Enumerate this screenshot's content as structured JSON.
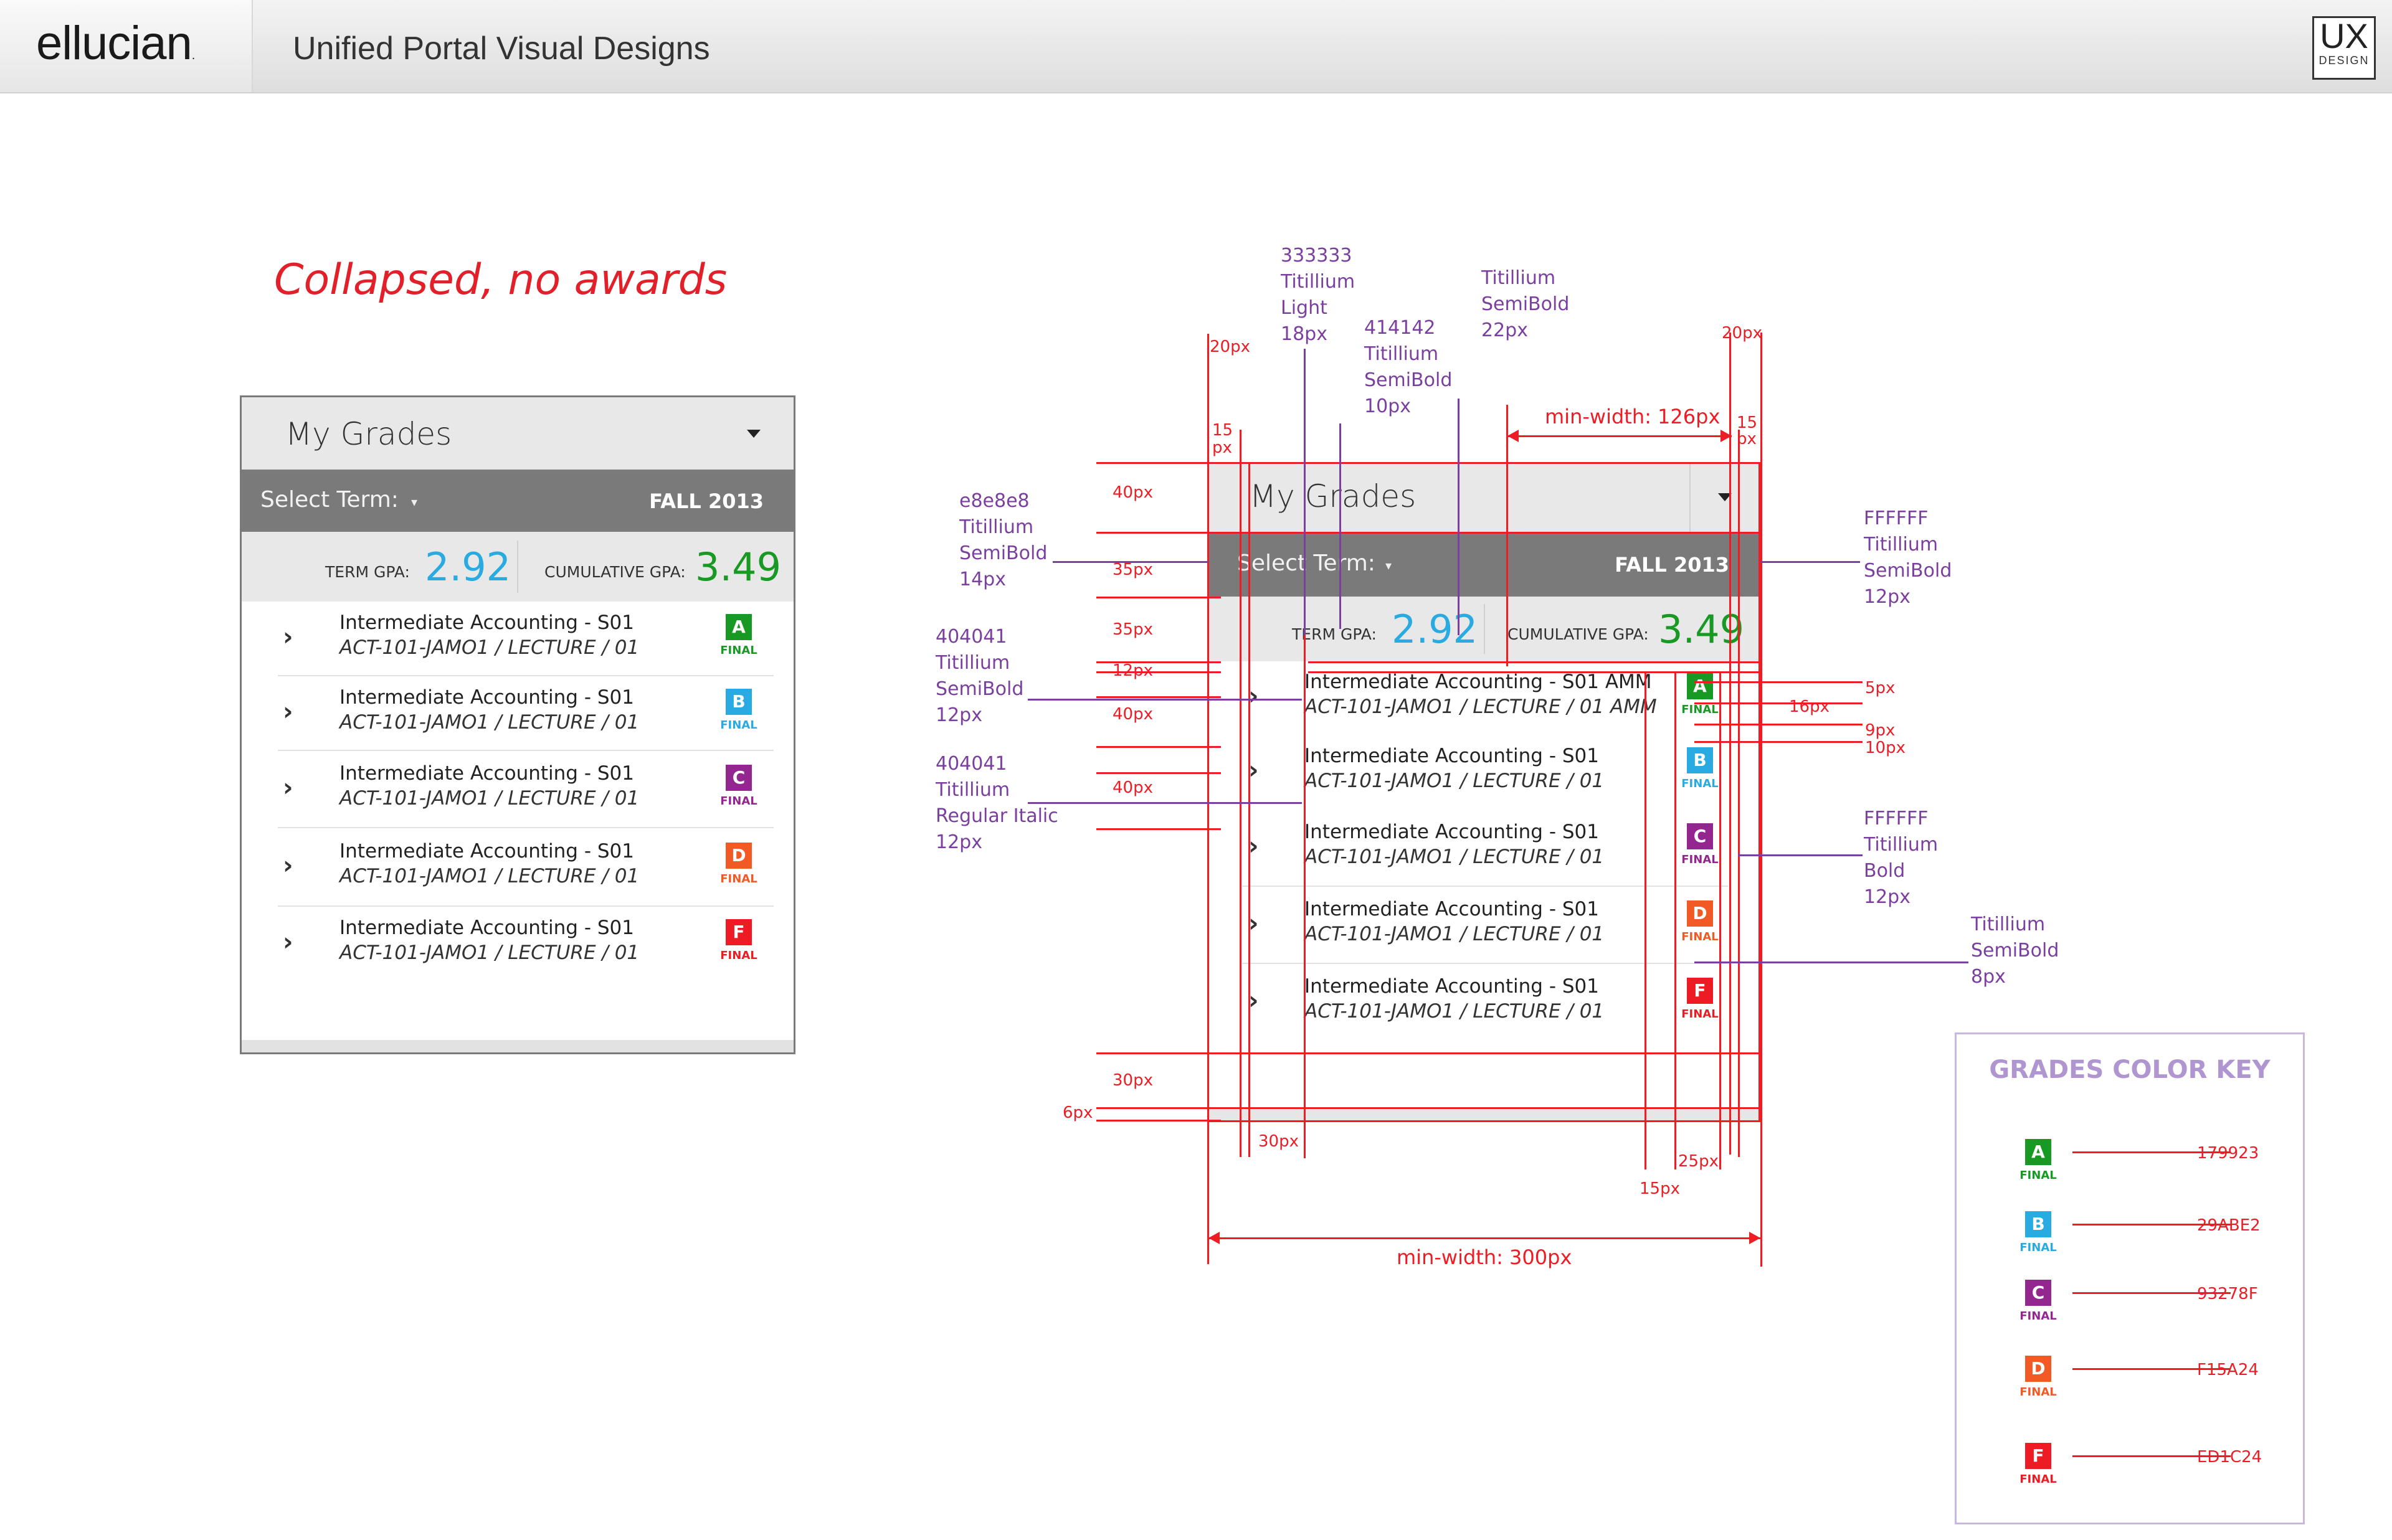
{
  "header": {
    "brand": "ellucian",
    "brand_mark": ".",
    "title": "Unified Portal Visual Designs",
    "ux_badge": "UX",
    "ux_badge_sub": "DESIGN"
  },
  "section_title": "Collapsed, no awards",
  "colors": {
    "A": "#179923",
    "B": "#29ABE2",
    "C": "#93278F",
    "D": "#F15A24",
    "F": "#ED1C24",
    "term_gpa": "#29ABE2",
    "cumulative_gpa": "#179923",
    "annotation_red": "#ef1c24",
    "annotation_purple": "#7b3fa0"
  },
  "widget_left": {
    "title": "My Grades",
    "select_term_label": "Select Term:",
    "term_value": "FALL 2013",
    "term_gpa_label": "TERM GPA:",
    "term_gpa": "2.92",
    "cumulative_gpa_label": "CUMULATIVE GPA:",
    "cumulative_gpa": "3.49",
    "courses": [
      {
        "name": "Intermediate Accounting - S01",
        "code": "ACT-101-JAMO1 / LECTURE / 01",
        "grade": "A",
        "status": "FINAL"
      },
      {
        "name": "Intermediate Accounting - S01",
        "code": "ACT-101-JAMO1 / LECTURE / 01",
        "grade": "B",
        "status": "FINAL"
      },
      {
        "name": "Intermediate Accounting - S01",
        "code": "ACT-101-JAMO1 / LECTURE / 01",
        "grade": "C",
        "status": "FINAL"
      },
      {
        "name": "Intermediate Accounting - S01",
        "code": "ACT-101-JAMO1 / LECTURE / 01",
        "grade": "D",
        "status": "FINAL"
      },
      {
        "name": "Intermediate Accounting - S01",
        "code": "ACT-101-JAMO1 / LECTURE / 01",
        "grade": "F",
        "status": "FINAL"
      }
    ]
  },
  "widget_spec": {
    "title": "My Grades",
    "select_term_label": "Select Term:",
    "term_value": "FALL 2013",
    "term_gpa_label": "TERM GPA:",
    "term_gpa": "2.92",
    "cumulative_gpa_label": "CUMULATIVE GPA:",
    "cumulative_gpa": "3.49",
    "courses": [
      {
        "name": "Intermediate Accounting - S01 AMM",
        "code": "ACT-101-JAMO1 / LECTURE / 01 AMM",
        "grade": "A",
        "status": "FINAL"
      },
      {
        "name": "Intermediate Accounting - S01",
        "code": "ACT-101-JAMO1 / LECTURE / 01",
        "grade": "B",
        "status": "FINAL"
      },
      {
        "name": "Intermediate Accounting - S01",
        "code": "ACT-101-JAMO1 / LECTURE / 01",
        "grade": "C",
        "status": "FINAL"
      },
      {
        "name": "Intermediate Accounting - S01",
        "code": "ACT-101-JAMO1 / LECTURE / 01",
        "grade": "D",
        "status": "FINAL"
      },
      {
        "name": "Intermediate Accounting - S01",
        "code": "ACT-101-JAMO1 / LECTURE / 01",
        "grade": "F",
        "status": "FINAL"
      }
    ]
  },
  "annotations": {
    "purple": {
      "title_font": "333333\nTitillium\nLight\n18px",
      "gpa_label_font": "414142\nTitillium\nSemiBold\n10px",
      "gpa_value_font": "Titillium\nSemiBold\n22px",
      "term_bar_bg": "e8e8e8\nTitillium\nSemiBold\n14px",
      "course_name_font": "404041\nTitillium\nSemiBold\n12px",
      "course_code_font": "404041\nTitillium\nRegular Italic\n12px",
      "term_bar_text": "FFFFFF\nTitillium\nSemiBold\n12px",
      "badge_font": "FFFFFF\nTitillium\nBold\n12px",
      "final_font": "Titillium\nSemiBold\n8px"
    },
    "red": {
      "left_20": "20px",
      "right_20": "20px",
      "left_15a": "15",
      "left_15b": "px",
      "right_15a": "15",
      "right_15b": "px",
      "min_width_126": "min-width: 126px",
      "h40a": "40px",
      "h35a": "35px",
      "h35b": "35px",
      "h12": "12px",
      "h40b": "40px",
      "h40c": "40px",
      "h30": "30px",
      "h6": "6px",
      "w30": "30px",
      "w15": "15px",
      "w25": "25px",
      "r5": "5px",
      "r16": "16px",
      "r9": "9px",
      "r10": "10px",
      "min_width_300": "min-width: 300px"
    }
  },
  "color_key": {
    "title": "GRADES COLOR KEY",
    "items": [
      {
        "grade": "A",
        "status": "FINAL",
        "hex": "179923"
      },
      {
        "grade": "B",
        "status": "FINAL",
        "hex": "29ABE2"
      },
      {
        "grade": "C",
        "status": "FINAL",
        "hex": "93278F"
      },
      {
        "grade": "D",
        "status": "FINAL",
        "hex": "F15A24"
      },
      {
        "grade": "F",
        "status": "FINAL",
        "hex": "ED1C24"
      }
    ]
  }
}
